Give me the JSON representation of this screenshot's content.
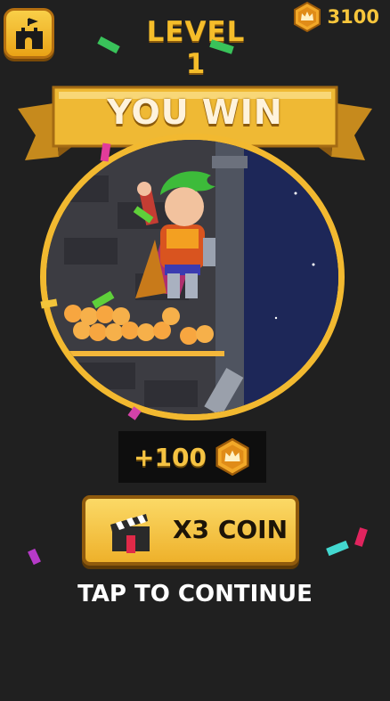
{
  "header": {
    "home_icon": "castle-icon",
    "level_title": "LEVEL 1",
    "coin_icon": "crown-coin-icon",
    "coin_balance": "3100"
  },
  "result": {
    "banner_text": "YOU WIN"
  },
  "reward": {
    "amount": "+100",
    "coin_icon": "crown-coin-icon"
  },
  "multiplier_button": {
    "icon": "clapperboard-icon",
    "label": "X3 COIN"
  },
  "footer": {
    "tap_text": "TAP TO CONTINUE"
  },
  "colors": {
    "background": "#202020",
    "gold": "#f2b930",
    "button_gold": "#eeb12b"
  }
}
